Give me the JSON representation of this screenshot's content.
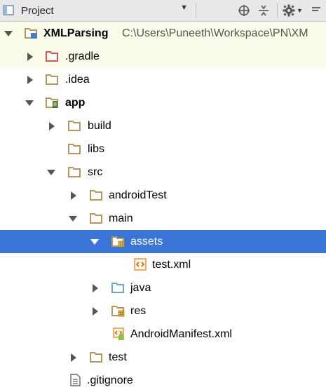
{
  "toolbar": {
    "view_label": "Project",
    "icons": [
      "project-view-icon",
      "dropdown-arrow-icon",
      "locate-icon",
      "collapse-all-icon",
      "settings-gear-icon",
      "hide-icon"
    ]
  },
  "tree": {
    "root_name": "XMLParsing",
    "root_path": "C:\\Users\\Puneeth\\Workspace\\PN\\XM",
    "items": [
      {
        "label": ".gradle"
      },
      {
        "label": ".idea"
      },
      {
        "label": "app"
      },
      {
        "label": "build"
      },
      {
        "label": "libs"
      },
      {
        "label": "src"
      },
      {
        "label": "androidTest"
      },
      {
        "label": "main"
      },
      {
        "label": "assets"
      },
      {
        "label": "test.xml"
      },
      {
        "label": "java"
      },
      {
        "label": "res"
      },
      {
        "label": "AndroidManifest.xml"
      },
      {
        "label": "test"
      },
      {
        "label": ".gitignore"
      }
    ]
  },
  "colors": {
    "selection": "#3875d7",
    "folder": "#c0a46c",
    "gradle_folder": "#d9534f",
    "source_folder": "#6aa6d6",
    "highlight_row": "#fbfbe9"
  }
}
